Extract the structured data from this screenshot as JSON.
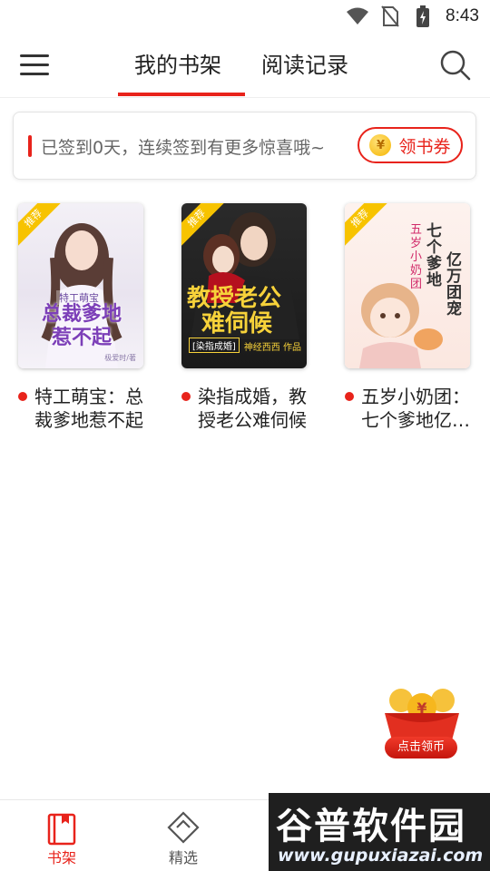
{
  "status_bar": {
    "time": "8:43",
    "icons": [
      "wifi-icon",
      "no-sim-icon",
      "battery-icon"
    ]
  },
  "header": {
    "tabs": [
      {
        "label": "我的书架",
        "active": true
      },
      {
        "label": "阅读记录",
        "active": false
      }
    ],
    "accent_color": "#e8231b"
  },
  "signin": {
    "text": "已签到0天，连续签到有更多惊喜哦~",
    "coupon_button": "领书券",
    "coin_symbol": "¥"
  },
  "books": [
    {
      "title": "特工萌宝：总裁爹地惹不起",
      "badge": "推荐",
      "cover": {
        "lines": [
          "特工萌宝",
          "总裁爹地",
          "惹不起"
        ],
        "author": "极爱时/著"
      }
    },
    {
      "title": "染指成婚，教授老公难伺候",
      "badge": "推荐",
      "cover": {
        "lines": [
          "教授老公",
          "难伺候"
        ],
        "tag": "[染指成婚]",
        "author": "神经西西 作品"
      }
    },
    {
      "title": "五岁小奶团：七个爹地亿万团宠",
      "badge": "推荐",
      "cover": {
        "lines": [
          "七个爹地",
          "亿万团宠",
          "五岁小奶团"
        ]
      }
    }
  ],
  "reward": {
    "label": "点击领币",
    "coin_symbol": "¥"
  },
  "tabbar": {
    "items": [
      {
        "label": "书架",
        "active": true
      },
      {
        "label": "精选",
        "active": false
      }
    ]
  },
  "watermark": {
    "big": "谷普软件园",
    "small": "www.gupuxiazai.com"
  }
}
